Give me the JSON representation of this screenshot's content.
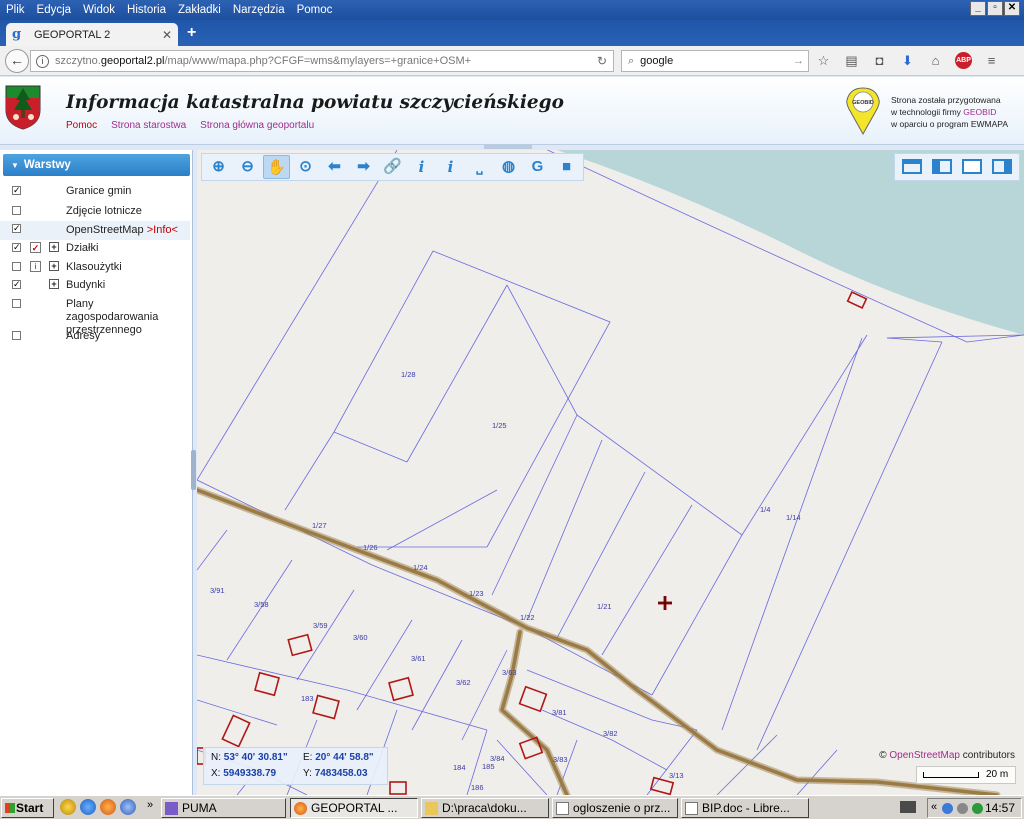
{
  "browser": {
    "menu": [
      "Plik",
      "Edycja",
      "Widok",
      "Historia",
      "Zakładki",
      "Narzędzia",
      "Pomoc"
    ],
    "tab_title": "GEOPORTAL 2",
    "url_prefix": "szczytno.",
    "url_domain": "geoportal2.pl",
    "url_rest": "/map/www/mapa.php?CFGF=wms&mylayers=+granice+OSM+",
    "search_value": "google",
    "abp_label": "ABP"
  },
  "header": {
    "title": "Informacja katastralna powiatu szczycieńskiego",
    "links": [
      "Pomoc",
      "Strona starostwa",
      "Strona główna geoportalu"
    ],
    "geobid_logo_text": "GEOBID",
    "geobid_line1": "Strona została przygotowana",
    "geobid_line2_pre": "w technologii firmy ",
    "geobid_line2_brand": "GEOBID",
    "geobid_line3": "w oparciu o program EWMAPA"
  },
  "sidebar": {
    "heading": "Warstwy",
    "layers": [
      {
        "label": "Granice gmin",
        "checked": true
      },
      {
        "label": "Zdjęcie lotnicze",
        "checked": false
      },
      {
        "label": "OpenStreetMap",
        "link": ">Info<",
        "checked": true
      },
      {
        "label": "Działki",
        "checked": true
      },
      {
        "label": "Klasoużytki",
        "checked": false
      },
      {
        "label": "Budynki",
        "checked": true
      },
      {
        "label": "Plany zagospodarowania przestrzennego",
        "checked": false
      },
      {
        "label": "Adresy",
        "checked": false
      }
    ]
  },
  "map": {
    "parcels": [
      "1/28",
      "1/25",
      "1/27",
      "1/26",
      "1/24",
      "1/23",
      "1/22",
      "1/21",
      "1/4",
      "1/14",
      "3/91",
      "3/58",
      "3/59",
      "3/60",
      "3/61",
      "3/62",
      "3/63",
      "3/81",
      "3/82",
      "3/83",
      "3/84",
      "183",
      "184",
      "185",
      "186",
      "3/13"
    ],
    "coords": {
      "n_label": "N:",
      "n_value": "53° 40' 30.81\"",
      "e_label": "E:",
      "e_value": "20° 44' 58.8\"",
      "x_label": "X:",
      "x_value": "5949338.79",
      "y_label": "Y:",
      "y_value": "7483458.03"
    },
    "attribution_pre": "© ",
    "attribution_link": "OpenStreetMap",
    "attribution_post": " contributors",
    "scale_label": "20 m"
  },
  "taskbar": {
    "start": "Start",
    "items": [
      "PUMA",
      "GEOPORTAL ...",
      "D:\\praca\\doku...",
      "ogloszenie o prz...",
      "BIP.doc - Libre..."
    ],
    "clock": "14:57"
  }
}
